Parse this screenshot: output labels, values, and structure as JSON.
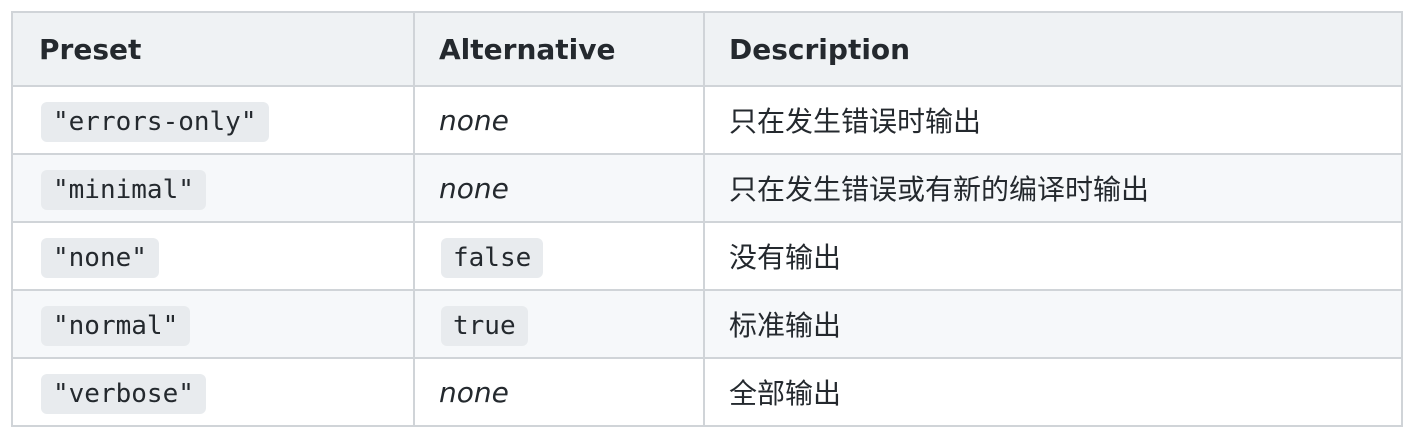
{
  "table": {
    "headers": [
      "Preset",
      "Alternative",
      "Description"
    ],
    "rows": [
      {
        "preset": "\"errors-only\"",
        "alternative": "none",
        "alternative_is_code": false,
        "description": "只在发生错误时输出"
      },
      {
        "preset": "\"minimal\"",
        "alternative": "none",
        "alternative_is_code": false,
        "description": "只在发生错误或有新的编译时输出"
      },
      {
        "preset": "\"none\"",
        "alternative": "false",
        "alternative_is_code": true,
        "description": "没有输出"
      },
      {
        "preset": "\"normal\"",
        "alternative": "true",
        "alternative_is_code": true,
        "description": "标准输出"
      },
      {
        "preset": "\"verbose\"",
        "alternative": "none",
        "alternative_is_code": false,
        "description": "全部输出"
      }
    ]
  }
}
